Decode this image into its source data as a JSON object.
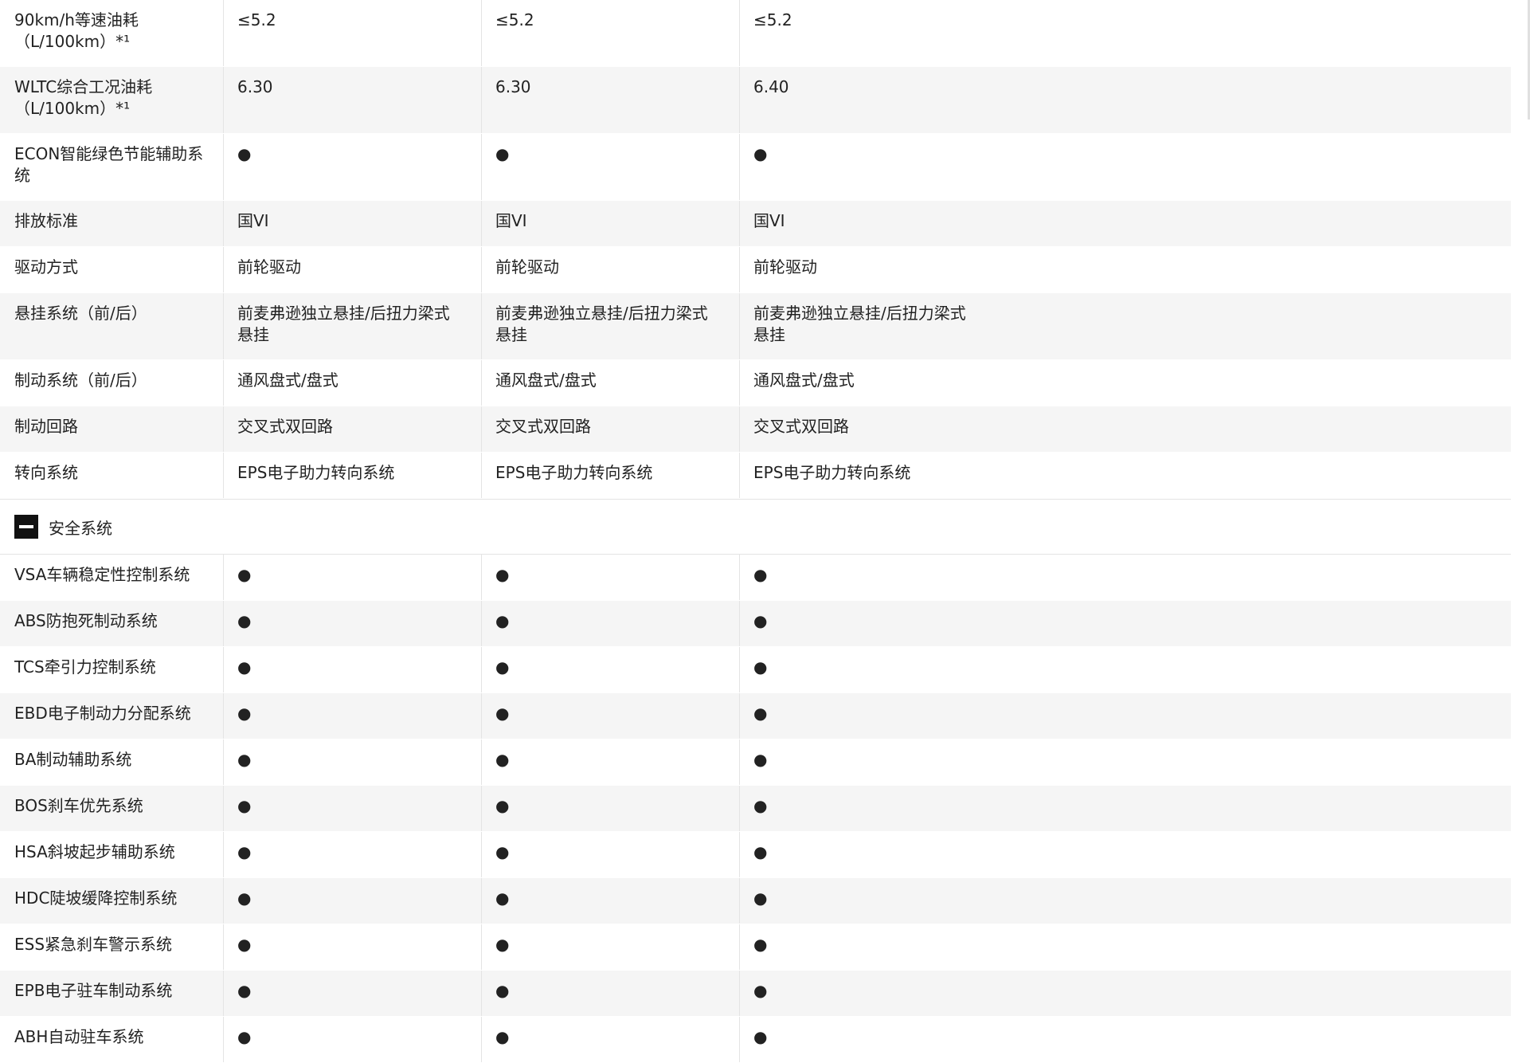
{
  "rows_top": [
    {
      "label": "90km/h等速油耗\n（L/100km）*¹",
      "values": [
        "≤5.2",
        "≤5.2",
        "≤5.2"
      ],
      "shade": false,
      "h": 84
    },
    {
      "label": "WLTC综合工况油耗\n（L/100km）*¹",
      "values": [
        "6.30",
        "6.30",
        "6.40"
      ],
      "shade": true,
      "h": 84
    },
    {
      "label": "ECON智能绿色节能辅助系\n统",
      "values": [
        "●",
        "●",
        "●"
      ],
      "shade": false,
      "h": 84
    },
    {
      "label": "排放标准",
      "values": [
        "国VI",
        "国VI",
        "国VI"
      ],
      "shade": true,
      "h": 58
    },
    {
      "label": "驱动方式",
      "values": [
        "前轮驱动",
        "前轮驱动",
        "前轮驱动"
      ],
      "shade": false,
      "h": 58
    },
    {
      "label": "悬挂系统（前/后）",
      "values": [
        "前麦弗逊独立悬挂/后扭力梁式\n悬挂",
        "前麦弗逊独立悬挂/后扭力梁式\n悬挂",
        "前麦弗逊独立悬挂/后扭力梁式\n悬挂"
      ],
      "shade": true,
      "h": 84
    },
    {
      "label": "制动系统（前/后）",
      "values": [
        "通风盘式/盘式",
        "通风盘式/盘式",
        "通风盘式/盘式"
      ],
      "shade": false,
      "h": 58
    },
    {
      "label": "制动回路",
      "values": [
        "交叉式双回路",
        "交叉式双回路",
        "交叉式双回路"
      ],
      "shade": true,
      "h": 58
    },
    {
      "label": "转向系统",
      "values": [
        "EPS电子助力转向系统",
        "EPS电子助力转向系统",
        "EPS电子助力转向系统"
      ],
      "shade": false,
      "h": 58
    }
  ],
  "section": {
    "title": "安全系统"
  },
  "rows_bottom": [
    {
      "label": "VSA车辆稳定性控制系统",
      "values": [
        "●",
        "●",
        "●"
      ],
      "shade": false
    },
    {
      "label": "ABS防抱死制动系统",
      "values": [
        "●",
        "●",
        "●"
      ],
      "shade": true
    },
    {
      "label": "TCS牵引力控制系统",
      "values": [
        "●",
        "●",
        "●"
      ],
      "shade": false
    },
    {
      "label": "EBD电子制动力分配系统",
      "values": [
        "●",
        "●",
        "●"
      ],
      "shade": true
    },
    {
      "label": "BA制动辅助系统",
      "values": [
        "●",
        "●",
        "●"
      ],
      "shade": false
    },
    {
      "label": "BOS刹车优先系统",
      "values": [
        "●",
        "●",
        "●"
      ],
      "shade": true
    },
    {
      "label": "HSA斜坡起步辅助系统",
      "values": [
        "●",
        "●",
        "●"
      ],
      "shade": false
    },
    {
      "label": "HDC陡坡缓降控制系统",
      "values": [
        "●",
        "●",
        "●"
      ],
      "shade": true
    },
    {
      "label": "ESS紧急刹车警示系统",
      "values": [
        "●",
        "●",
        "●"
      ],
      "shade": false
    },
    {
      "label": "EPB电子驻车制动系统",
      "values": [
        "●",
        "●",
        "●"
      ],
      "shade": true
    },
    {
      "label": "ABH自动驻车系统",
      "values": [
        "●",
        "●",
        "●"
      ],
      "shade": false
    }
  ]
}
